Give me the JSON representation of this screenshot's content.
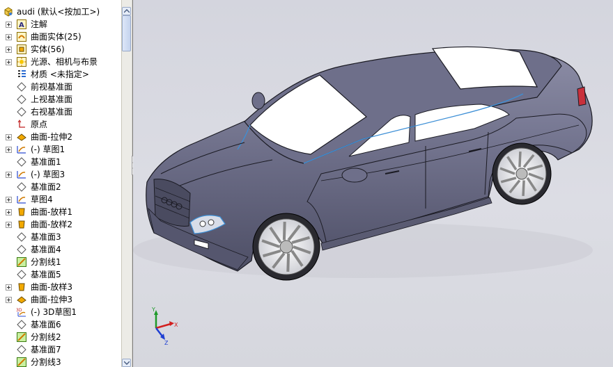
{
  "tree": {
    "root": {
      "label": "audi (默认<按加工>)",
      "icon": "part-icon"
    },
    "items": [
      {
        "label": "注解",
        "icon": "annotation-icon",
        "expandable": true
      },
      {
        "label": "曲面实体(25)",
        "icon": "surface-bodies-icon",
        "expandable": true
      },
      {
        "label": "实体(56)",
        "icon": "solid-bodies-icon",
        "expandable": true
      },
      {
        "label": "光源、相机与布景",
        "icon": "lights-cameras-icon",
        "expandable": true
      },
      {
        "label": "材质 <未指定>",
        "icon": "material-icon",
        "expandable": false
      },
      {
        "label": "前视基准面",
        "icon": "plane-icon",
        "expandable": false
      },
      {
        "label": "上视基准面",
        "icon": "plane-icon",
        "expandable": false
      },
      {
        "label": "右视基准面",
        "icon": "plane-icon",
        "expandable": false
      },
      {
        "label": "原点",
        "icon": "origin-icon",
        "expandable": false
      },
      {
        "label": "曲面-拉伸2",
        "icon": "surface-extrude-icon",
        "expandable": true
      },
      {
        "label": "(-) 草图1",
        "icon": "sketch-icon",
        "expandable": true
      },
      {
        "label": "基准面1",
        "icon": "plane-icon",
        "expandable": false
      },
      {
        "label": "(-) 草图3",
        "icon": "sketch-icon",
        "expandable": true
      },
      {
        "label": "基准面2",
        "icon": "plane-icon",
        "expandable": false
      },
      {
        "label": "草图4",
        "icon": "sketch-icon",
        "expandable": true
      },
      {
        "label": "曲面-放样1",
        "icon": "surface-loft-icon",
        "expandable": true
      },
      {
        "label": "曲面-放样2",
        "icon": "surface-loft-icon",
        "expandable": true
      },
      {
        "label": "基准面3",
        "icon": "plane-icon",
        "expandable": false
      },
      {
        "label": "基准面4",
        "icon": "plane-icon",
        "expandable": false
      },
      {
        "label": "分割线1",
        "icon": "split-line-icon",
        "expandable": false
      },
      {
        "label": "基准面5",
        "icon": "plane-icon",
        "expandable": false
      },
      {
        "label": "曲面-放样3",
        "icon": "surface-loft-icon",
        "expandable": true
      },
      {
        "label": "曲面-拉伸3",
        "icon": "surface-extrude-icon",
        "expandable": true
      },
      {
        "label": "(-) 3D草图1",
        "icon": "3d-sketch-icon",
        "expandable": false
      },
      {
        "label": "基准面6",
        "icon": "plane-icon",
        "expandable": false
      },
      {
        "label": "分割线2",
        "icon": "split-line-icon",
        "expandable": false
      },
      {
        "label": "基准面7",
        "icon": "plane-icon",
        "expandable": false
      },
      {
        "label": "分割线3",
        "icon": "split-line-icon",
        "expandable": false
      }
    ]
  },
  "triad": {
    "x_label": "X",
    "y_label": "Y",
    "z_label": "Z"
  },
  "colors": {
    "car_body": "#6b6c86",
    "glass": "#ffffff",
    "viewport_bg": "#dcdde4"
  }
}
